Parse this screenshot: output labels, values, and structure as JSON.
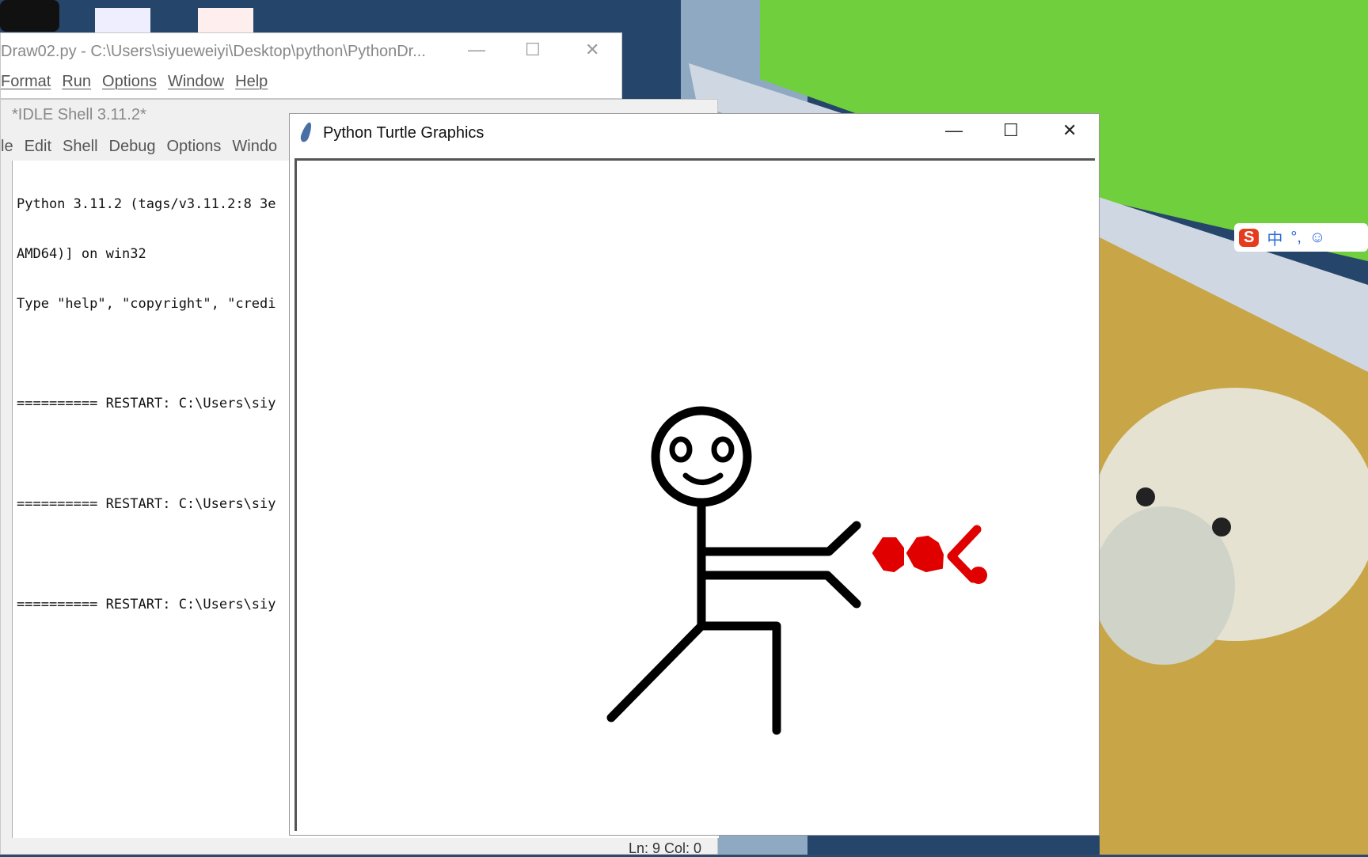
{
  "editor": {
    "title": "Draw02.py - C:\\Users\\siyueweiyi\\Desktop\\python\\PythonDr...",
    "menu": [
      "Format",
      "Run",
      "Options",
      "Window",
      "Help"
    ]
  },
  "shell": {
    "title": "*IDLE Shell 3.11.2*",
    "menu": [
      "le",
      "Edit",
      "Shell",
      "Debug",
      "Options",
      "Windo"
    ],
    "lines": [
      "Python 3.11.2 (tags/v3.11.2:8 3e",
      "AMD64)] on win32",
      "Type \"help\", \"copyright\", \"credi",
      "",
      "========== RESTART: C:\\Users\\siy",
      "",
      "========== RESTART: C:\\Users\\siy",
      "",
      "========== RESTART: C:\\Users\\siy"
    ],
    "status": "Ln: 9  Col: 0"
  },
  "turtle": {
    "title": "Python Turtle Graphics",
    "drawing_colors": {
      "figure": "#000000",
      "hearts": "#e00000"
    }
  },
  "ime": {
    "labels": [
      "中",
      "°,",
      "☺"
    ]
  }
}
